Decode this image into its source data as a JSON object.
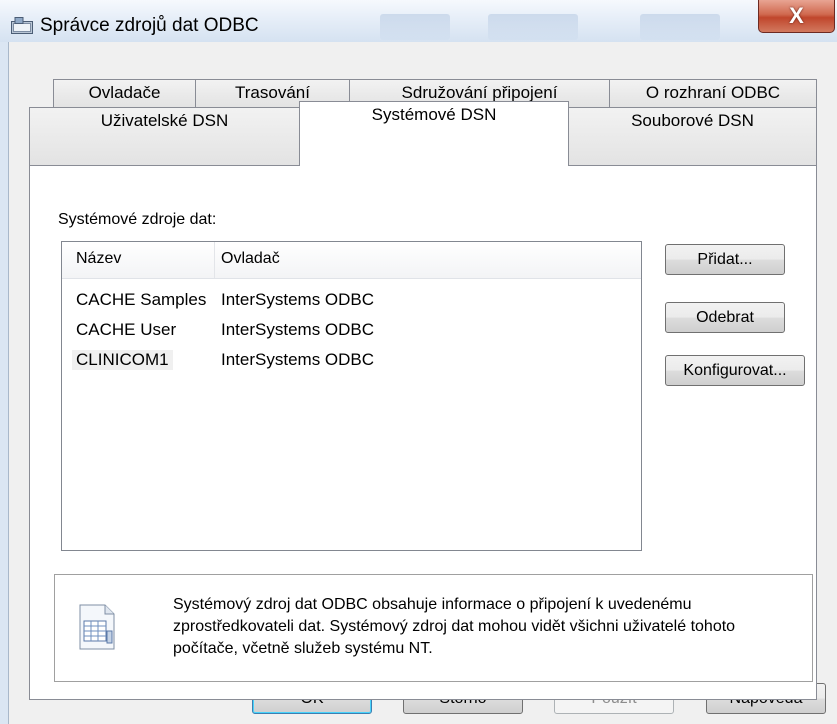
{
  "window": {
    "title": "Správce zdrojů dat ODBC",
    "close_glyph": "X"
  },
  "tabs_row1": [
    {
      "label": "Ovladače"
    },
    {
      "label": "Trasování"
    },
    {
      "label": "Sdružování připojení"
    },
    {
      "label": "O rozhraní ODBC"
    }
  ],
  "tabs_row2": [
    {
      "label": "Uživatelské DSN"
    },
    {
      "label": "Systémové DSN",
      "active": true
    },
    {
      "label": "Souborové DSN"
    }
  ],
  "panel": {
    "sources_label": "Systémové zdroje dat:",
    "list": {
      "columns": [
        "Název",
        "Ovladač"
      ],
      "rows": [
        {
          "name": "CACHE Samples",
          "driver": "InterSystems ODBC"
        },
        {
          "name": "CACHE User",
          "driver": "InterSystems ODBC"
        },
        {
          "name": "CLINICOM1",
          "driver": "InterSystems ODBC",
          "selected": true
        }
      ]
    },
    "buttons": {
      "add": "Přidat...",
      "remove": "Odebrat",
      "configure": "Konfigurovat..."
    },
    "info": {
      "icon": "data-source-document-icon",
      "text": "Systémový zdroj dat ODBC obsahuje informace o připojení k uvedenému zprostředkovateli dat. Systémový zdroj dat mohou vidět všichni uživatelé tohoto počítače, včetně služeb systému NT."
    }
  },
  "footer": {
    "ok": "OK",
    "cancel": "Storno",
    "apply": "Použít",
    "help": "Nápověda"
  },
  "colors": {
    "window_frame": "#dfe9f5",
    "client": "#f0f0f0",
    "close_button": "#c75a44",
    "selection": "#f0f0f0"
  }
}
